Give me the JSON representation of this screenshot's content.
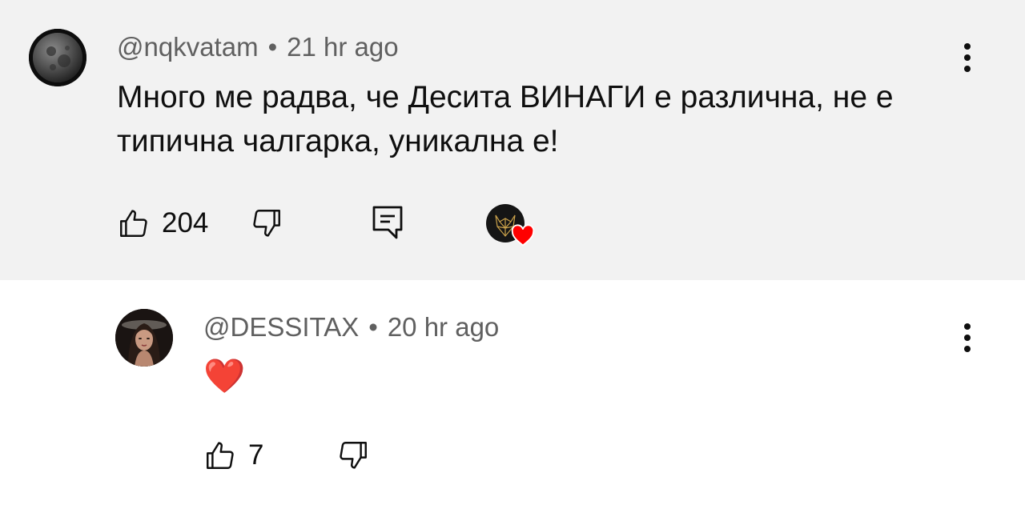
{
  "comments": [
    {
      "handle": "@nqkvatam",
      "separator": "•",
      "time": "21 hr ago",
      "text": "Много ме радва, че Десита ВИНАГИ е различна, не е типична чалгарка, уникална е!",
      "likes": "204",
      "avatar_icon": "moon-avatar",
      "has_reply_button": true,
      "creator_heart": true,
      "colors": {
        "background": "#f2f2f2"
      }
    },
    {
      "handle": "@DESSITAX",
      "separator": "•",
      "time": "20 hr ago",
      "text": "❤️",
      "likes": "7",
      "avatar_icon": "woman-portrait-avatar",
      "has_reply_button": false,
      "creator_heart": false,
      "colors": {
        "background": "#ffffff"
      }
    }
  ],
  "icons": {
    "like": "thumbs-up-icon",
    "dislike": "thumbs-down-icon",
    "reply": "reply-comment-icon",
    "menu": "more-vertical-icon",
    "heart": "heart-icon"
  },
  "colors": {
    "heart": "#ff0000",
    "meta_text": "#606060",
    "body_text": "#0f0f0f"
  }
}
